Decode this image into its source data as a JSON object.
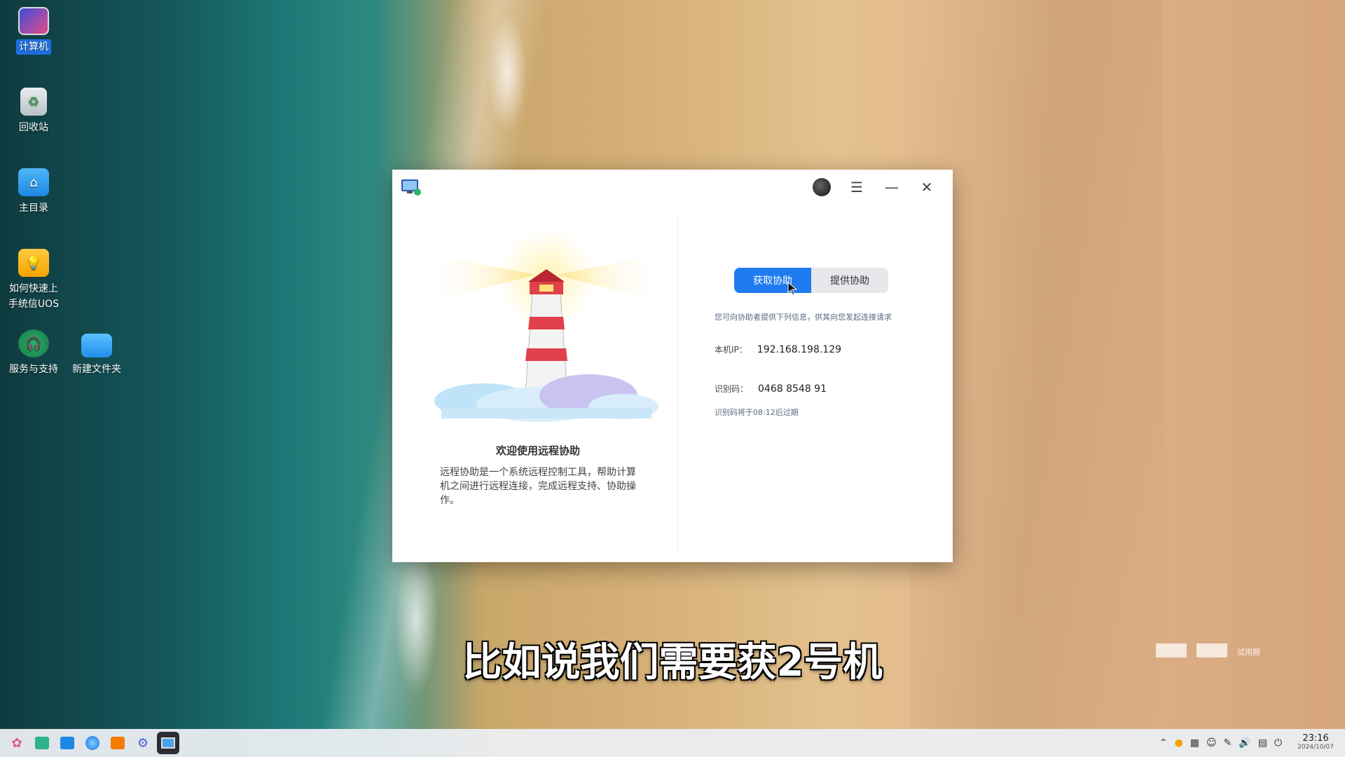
{
  "desktop": {
    "icons": [
      {
        "label": "计算机"
      },
      {
        "label": "回收站"
      },
      {
        "label": "主目录"
      },
      {
        "label": "如何快速上手统信UOS"
      },
      {
        "label": "服务与支持"
      },
      {
        "label": "新建文件夹"
      }
    ]
  },
  "window": {
    "left": {
      "welcome_title": "欢迎使用远程协助",
      "welcome_desc": "远程协助是一个系统远程控制工具，帮助计算机之间进行远程连接，完成远程支持、协助操作。"
    },
    "right": {
      "tab_get": "获取协助",
      "tab_give": "提供协助",
      "hint": "您可向协助者提供下列信息，供其向您发起连接请求",
      "ip_label": "本机IP：",
      "ip_value": "192.168.198.129",
      "code_label": "识别码：",
      "code_value": "0468 8548 91",
      "expire_text": "识别码将于08:12后过期"
    }
  },
  "subtitle": "比如说我们需要获2号机",
  "watermark": "试用期",
  "taskbar": {
    "time": "23:16",
    "date": "2024/10/07"
  }
}
